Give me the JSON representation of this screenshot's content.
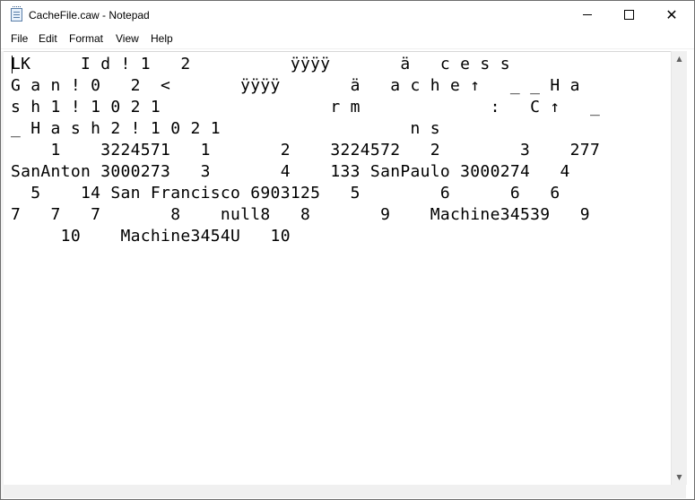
{
  "window": {
    "title": "CacheFile.caw - Notepad",
    "icon": "notepad-icon",
    "controls": {
      "minimize": "minimize-icon",
      "maximize": "maximize-icon",
      "close": "✕"
    }
  },
  "menu": {
    "file": "File",
    "edit": "Edit",
    "format": "Format",
    "view": "View",
    "help": "Help"
  },
  "editor": {
    "content": "LK     I d ! 1   2          ÿÿÿÿ       ä   c e s s \nG a n ! 0   2  <       ÿÿÿÿ       ä   a c h e ↑   _ _ H a\ns h 1 ! 1 0 2 1                 r m             :   C ↑   _\n_ H a s h 2 ! 1 0 2 1                   n s\n    1    3224571   1       2    3224572   2        3    277\nSanAnton 3000273   3       4    133 SanPaulo 3000274   4     \n  5    14 San Francisco 6903125   5        6      6   6     \n7   7   7       8    null8   8       9    Machine34539   9\n     10    Machine3454U   10"
  },
  "scrollbar": {
    "up": "▲",
    "down": "▼"
  }
}
